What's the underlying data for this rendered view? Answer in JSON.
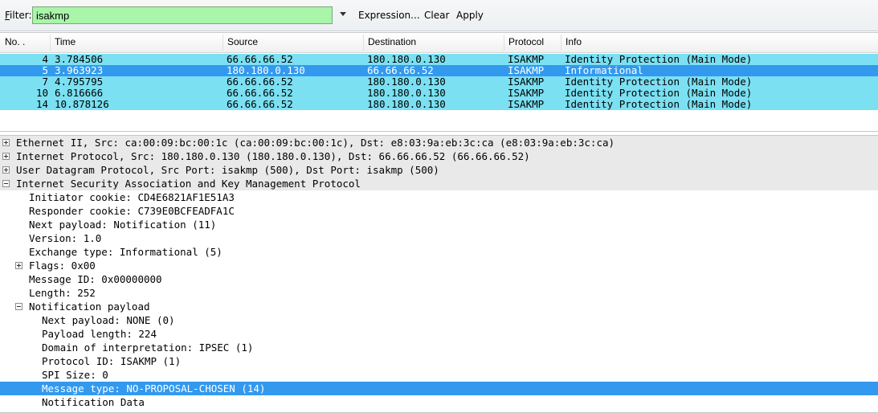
{
  "toolbar": {
    "filter_label_prefix": "F",
    "filter_label_rest": "ilter:",
    "filter_value": "isakmp",
    "expression_label": "Expression...",
    "clear_label": "Clear",
    "apply_label": "Apply"
  },
  "packet_list": {
    "columns": [
      "No. .",
      "Time",
      "Source",
      "Destination",
      "Protocol",
      "Info"
    ],
    "rows": [
      {
        "no": "4",
        "time": "3.784506",
        "src": "66.66.66.52",
        "dst": "180.180.0.130",
        "proto": "ISAKMP",
        "info": "Identity Protection (Main Mode)"
      },
      {
        "no": "5",
        "time": "3.963923",
        "src": "180.180.0.130",
        "dst": "66.66.66.52",
        "proto": "ISAKMP",
        "info": "Informational"
      },
      {
        "no": "7",
        "time": "4.795795",
        "src": "66.66.66.52",
        "dst": "180.180.0.130",
        "proto": "ISAKMP",
        "info": "Identity Protection (Main Mode)"
      },
      {
        "no": "10",
        "time": "6.816666",
        "src": "66.66.66.52",
        "dst": "180.180.0.130",
        "proto": "ISAKMP",
        "info": "Identity Protection (Main Mode)"
      },
      {
        "no": "14",
        "time": "10.878126",
        "src": "66.66.66.52",
        "dst": "180.180.0.130",
        "proto": "ISAKMP",
        "info": "Identity Protection (Main Mode)"
      }
    ]
  },
  "details": {
    "lines": [
      "Ethernet II, Src: ca:00:09:bc:00:1c (ca:00:09:bc:00:1c), Dst: e8:03:9a:eb:3c:ca (e8:03:9a:eb:3c:ca)",
      "Internet Protocol, Src: 180.180.0.130 (180.180.0.130), Dst: 66.66.66.52 (66.66.66.52)",
      "User Datagram Protocol, Src Port: isakmp (500), Dst Port: isakmp (500)",
      "Internet Security Association and Key Management Protocol",
      "Initiator cookie: CD4E6821AF1E51A3",
      "Responder cookie: C739E0BCFEADFA1C",
      "Next payload: Notification (11)",
      "Version: 1.0",
      "Exchange type: Informational (5)",
      "Flags: 0x00",
      "Message ID: 0x00000000",
      "Length: 252",
      "Notification payload",
      "Next payload: NONE (0)",
      "Payload length: 224",
      "Domain of interpretation: IPSEC (1)",
      "Protocol ID: ISAKMP (1)",
      "SPI Size: 0",
      "Message type: NO-PROPOSAL-CHOSEN (14)",
      "Notification Data"
    ]
  },
  "colors": {
    "filter_bg": "#a9f5a9",
    "row_bg": "#7be0f2",
    "selected_bg": "#3399ee",
    "shaded_bg": "#e9e9e9"
  }
}
